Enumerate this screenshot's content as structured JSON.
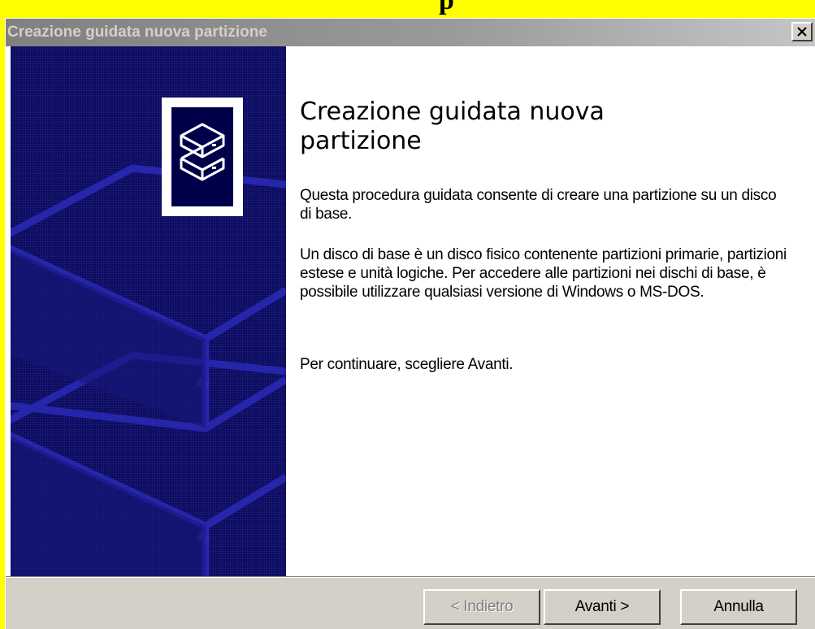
{
  "window": {
    "title": "Creazione guidata nuova partizione",
    "close_glyph": "×",
    "close_icon": "close-icon"
  },
  "top_strip": {
    "clipped_caption": "p"
  },
  "left_panel": {
    "logo_icon": "stacked-disks-icon",
    "background_art": "disk-drives-illustration"
  },
  "content": {
    "heading": "Creazione guidata nuova partizione",
    "paragraphs": [
      "Questa procedura guidata consente di creare una partizione su un disco di base.",
      "Un disco di base è un disco fisico contenente partizioni primarie, partizioni estese e unità logiche. Per accedere alle partizioni nei dischi di base, è possibile utilizzare qualsiasi versione di Windows o MS-DOS.",
      "Per continuare, scegliere Avanti."
    ]
  },
  "buttons": {
    "back": "< Indietro",
    "next": "Avanti >",
    "cancel": "Annulla"
  },
  "colors": {
    "title_bar_inactive": "#808080",
    "panel_navy": "#0a0a5c",
    "dialog_face": "#d4d0c8",
    "outer_highlight": "#ffff00"
  }
}
